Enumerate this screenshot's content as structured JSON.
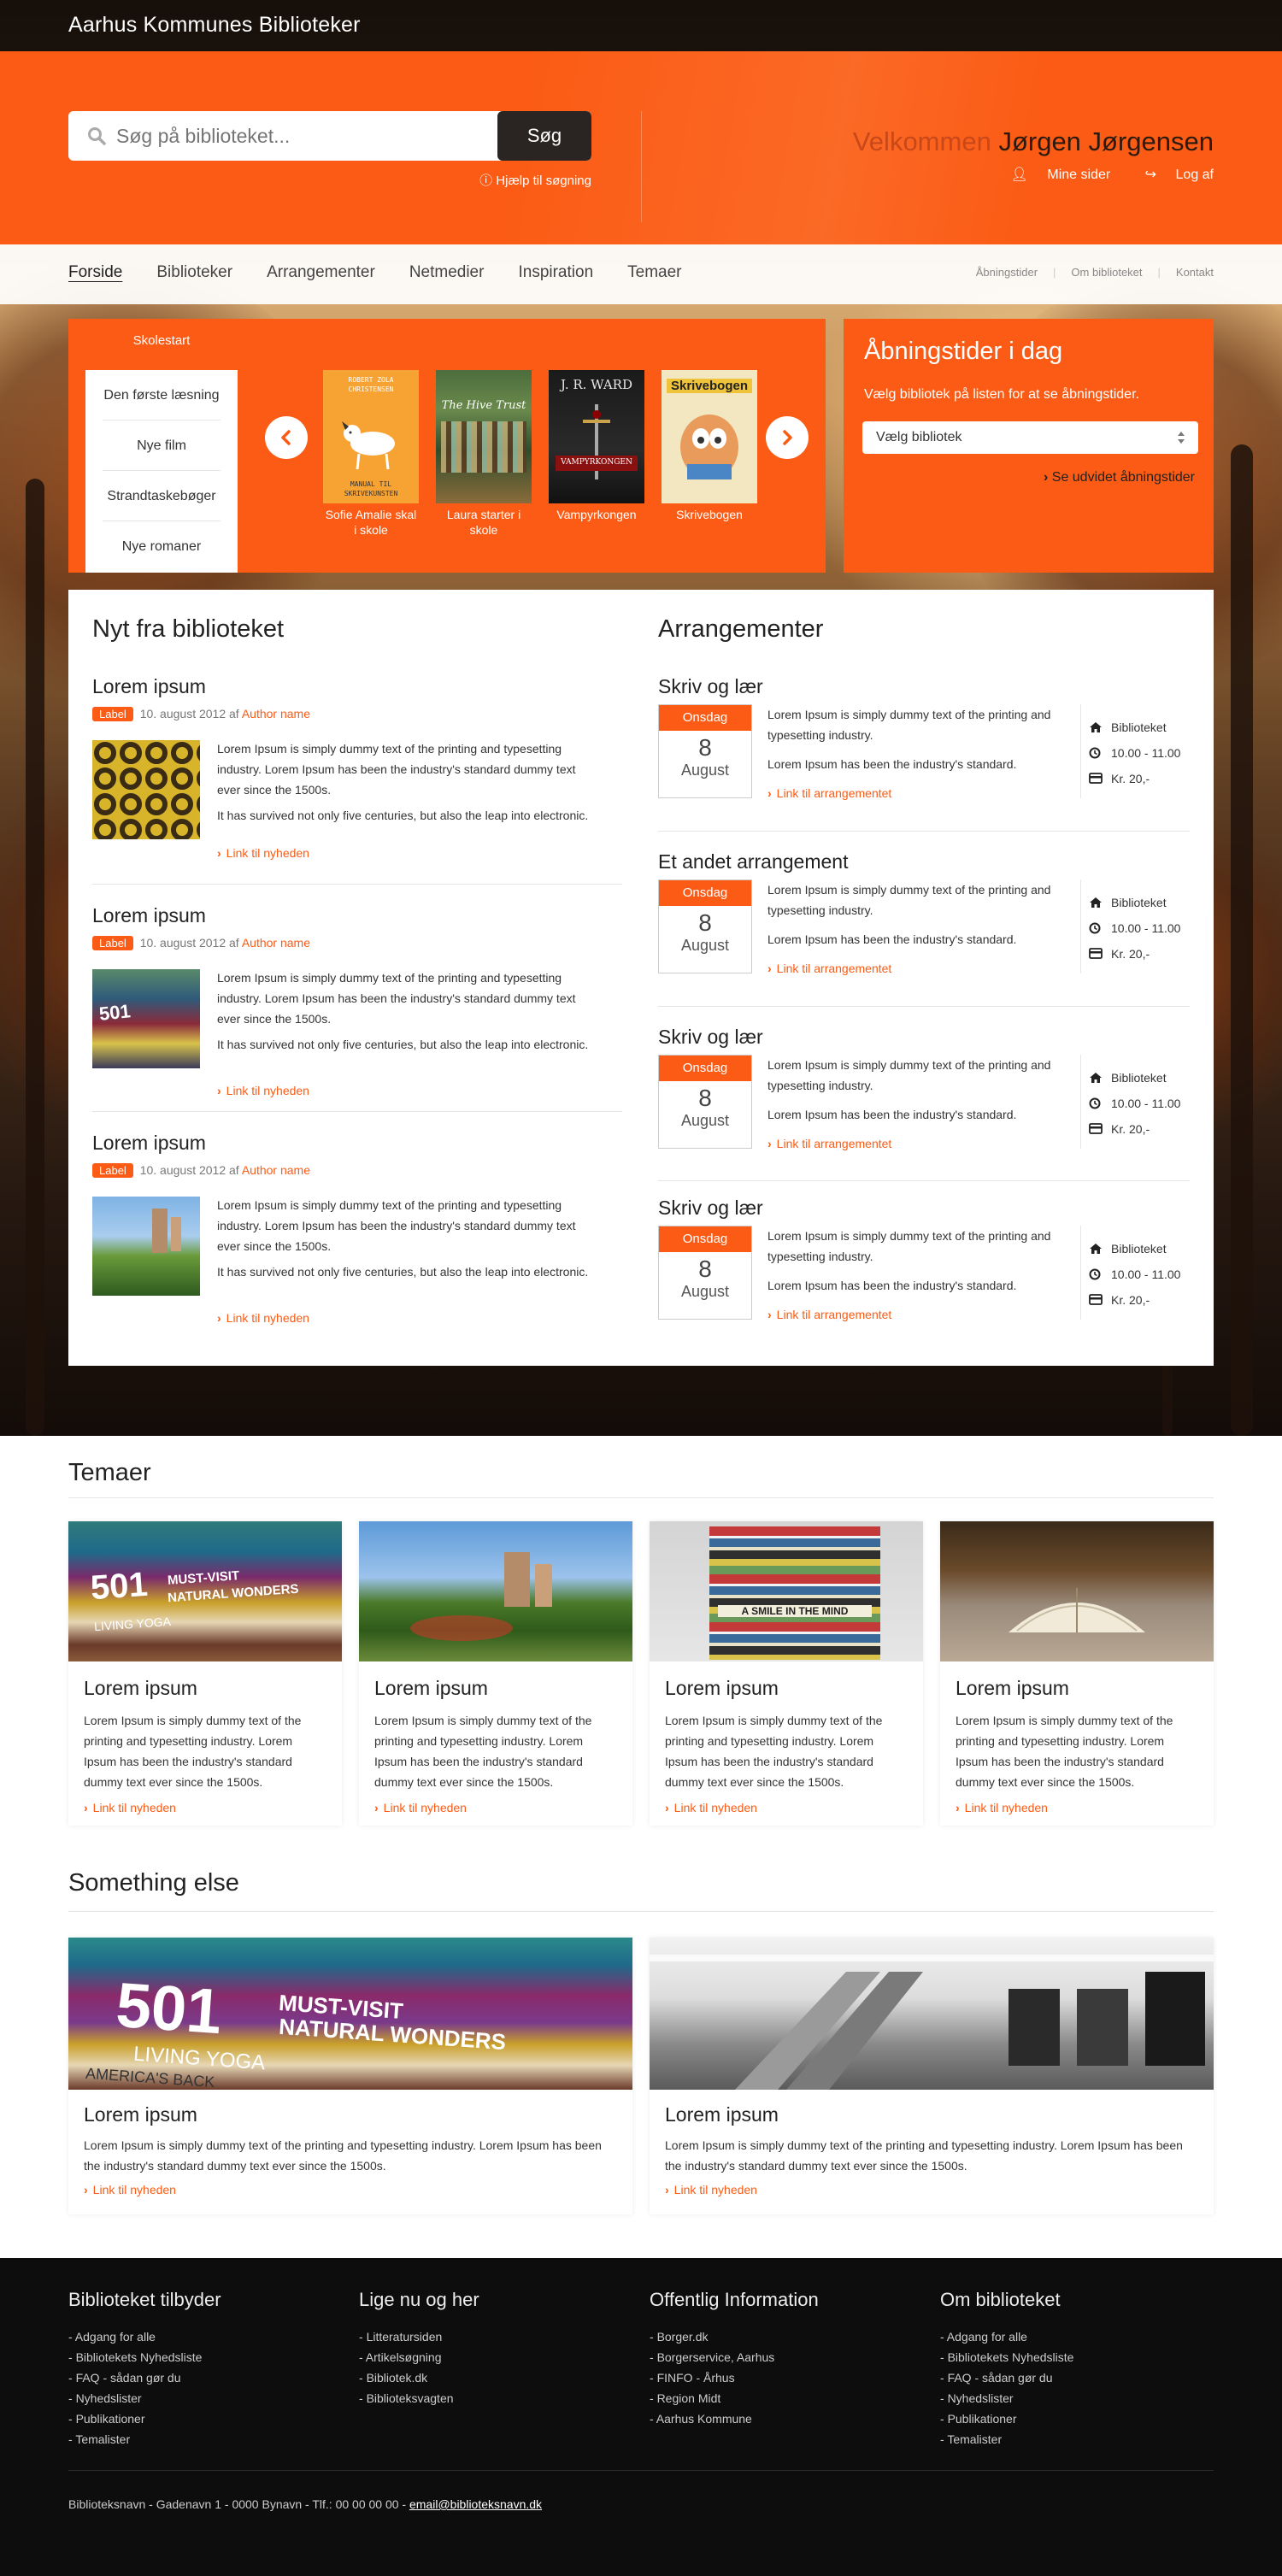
{
  "header": {
    "site_title": "Aarhus Kommunes Biblioteker"
  },
  "search": {
    "placeholder": "Søg på biblioteket...",
    "button": "Søg",
    "help": "Hjælp til søgning"
  },
  "user": {
    "welcome": "Velkommen",
    "name": "Jørgen Jørgensen",
    "my_pages": "Mine sider",
    "logout": "Log af"
  },
  "nav": {
    "items": [
      "Forside",
      "Biblioteker",
      "Arrangementer",
      "Netmedier",
      "Inspiration",
      "Temaer"
    ],
    "utility": [
      "Åbningstider",
      "Om biblioteket",
      "Kontakt"
    ]
  },
  "carousel": {
    "active_category": "Skolestart",
    "categories": [
      "Den første læsning",
      "Nye film",
      "Strandtaskebøger",
      "Nye romaner"
    ],
    "books": [
      {
        "title": "Sofie Amalie skal i skole",
        "cover_author": "ROBERT ZOLA CHRISTENSEN",
        "cover_title": "MANUAL TIL SKRIVEKUNSTEN"
      },
      {
        "title": "Laura starter i skole",
        "cover_title": "The Hive Trust"
      },
      {
        "title": "Vampyrkongen",
        "cover_author": "J. R. WARD",
        "cover_title": "VAMPYRKONGEN"
      },
      {
        "title": "Skrivebogen",
        "cover_title": "Skrivebogen"
      }
    ]
  },
  "hours": {
    "title": "Åbningstider i dag",
    "subtitle": "Vælg bibliotek på listen for at se åbningstider.",
    "select": "Vælg bibliotek",
    "link": "Se udvidet åbningstider"
  },
  "news": {
    "heading": "Nyt fra biblioteket",
    "items": [
      {
        "title": "Lorem ipsum",
        "label": "Label",
        "date": "10. august 2012 af",
        "author": "Author name",
        "p1": "Lorem Ipsum is simply dummy text of the printing and typesetting industry. Lorem Ipsum has been the industry's standard dummy text ever since the 1500s.",
        "p2": "It has survived not only five centuries, but also the leap into electronic.",
        "link": "Link til nyheden"
      },
      {
        "title": "Lorem ipsum",
        "label": "Label",
        "date": "10. august 2012 af",
        "author": "Author name",
        "p1": "Lorem Ipsum is simply dummy text of the printing and typesetting industry. Lorem Ipsum has been the industry's standard dummy text ever since the 1500s.",
        "p2": "It has survived not only five centuries, but also the leap into electronic.",
        "link": "Link til nyheden"
      },
      {
        "title": "Lorem ipsum",
        "label": "Label",
        "date": "10. august 2012 af",
        "author": "Author name",
        "p1": "Lorem Ipsum is simply dummy text of the printing and typesetting industry. Lorem Ipsum has been the industry's standard dummy text ever since the 1500s.",
        "p2": "It has survived not only five centuries, but also the leap into electronic.",
        "link": "Link til nyheden"
      }
    ]
  },
  "events": {
    "heading": "Arrangementer",
    "items": [
      {
        "title": "Skriv og lær",
        "day": "Onsdag",
        "date": "8",
        "month": "August",
        "p1": "Lorem Ipsum is simply dummy text of the printing and typesetting industry.",
        "p2": "Lorem Ipsum has been the industry's standard.",
        "link": "Link til arrangementet",
        "place": "Biblioteket",
        "time": "10.00 - 11.00",
        "price": "Kr. 20,-"
      },
      {
        "title": "Et andet arrangement",
        "day": "Onsdag",
        "date": "8",
        "month": "August",
        "p1": "Lorem Ipsum is simply dummy text of the printing and typesetting industry.",
        "p2": "Lorem Ipsum has been the industry's standard.",
        "link": "Link til arrangementet",
        "place": "Biblioteket",
        "time": "10.00 - 11.00",
        "price": "Kr. 20,-"
      },
      {
        "title": "Skriv og lær",
        "day": "Onsdag",
        "date": "8",
        "month": "August",
        "p1": "Lorem Ipsum is simply dummy text of the printing and typesetting industry.",
        "p2": "Lorem Ipsum has been the industry's standard.",
        "link": "Link til arrangementet",
        "place": "Biblioteket",
        "time": "10.00 - 11.00",
        "price": "Kr. 20,-"
      },
      {
        "title": "Skriv og lær",
        "day": "Onsdag",
        "date": "8",
        "month": "August",
        "p1": "Lorem Ipsum is simply dummy text of the printing and typesetting industry.",
        "p2": "Lorem Ipsum has been the industry's standard.",
        "link": "Link til arrangementet",
        "place": "Biblioteket",
        "time": "10.00 - 11.00",
        "price": "Kr. 20,-"
      }
    ]
  },
  "temaer": {
    "heading": "Temaer",
    "cards": [
      {
        "title": "Lorem ipsum",
        "text": "Lorem Ipsum is simply dummy text of the printing and typesetting industry. Lorem Ipsum has been the industry's standard dummy text ever since the 1500s.",
        "link": "Link til nyheden"
      },
      {
        "title": "Lorem ipsum",
        "text": "Lorem Ipsum is simply dummy text of the printing and typesetting industry. Lorem Ipsum has been the industry's standard dummy text ever since the 1500s.",
        "link": "Link til nyheden"
      },
      {
        "title": "Lorem ipsum",
        "text": "Lorem Ipsum is simply dummy text of the printing and typesetting industry. Lorem Ipsum has been the industry's standard dummy text ever since the 1500s.",
        "link": "Link til nyheden"
      },
      {
        "title": "Lorem ipsum",
        "text": "Lorem Ipsum is simply dummy text of the printing and typesetting industry. Lorem Ipsum has been the industry's standard dummy text ever since the 1500s.",
        "link": "Link til nyheden"
      }
    ]
  },
  "something": {
    "heading": "Something else",
    "cards": [
      {
        "title": "Lorem ipsum",
        "text": "Lorem Ipsum is simply dummy text of the printing and typesetting industry. Lorem Ipsum has been the industry's standard dummy text ever since the 1500s.",
        "link": "Link til nyheden"
      },
      {
        "title": "Lorem ipsum",
        "text": "Lorem Ipsum is simply dummy text of the printing and typesetting industry. Lorem Ipsum has been the industry's standard dummy text ever since the 1500s.",
        "link": "Link til nyheden"
      }
    ]
  },
  "book_spines": {
    "big": "501",
    "must": "MUST-VISIT",
    "natural": "NATURAL WONDERS",
    "yoga": "LIVING YOGA",
    "america": "AMERICA'S BACK",
    "smile": "A SMILE IN THE MIND"
  },
  "footer": {
    "columns": [
      {
        "heading": "Biblioteket tilbyder",
        "items": [
          "Adgang for alle",
          "Bibliotekets Nyhedsliste",
          "FAQ - sådan gør du",
          "Nyhedslister",
          "Publikationer",
          "Temalister"
        ]
      },
      {
        "heading": "Lige nu og her",
        "items": [
          "Litteratursiden",
          "Artikelsøgning",
          "Bibliotek.dk",
          "Biblioteksvagten"
        ]
      },
      {
        "heading": "Offentlig Information",
        "items": [
          "Borger.dk",
          "Borgerservice, Aarhus",
          "FINFO - Århus",
          "Region Midt",
          "Aarhus Kommune"
        ]
      },
      {
        "heading": "Om biblioteket",
        "items": [
          "Adgang for alle",
          "Bibliotekets Nyhedsliste",
          "FAQ - sådan gør du",
          "Nyhedslister",
          "Publikationer",
          "Temalister"
        ]
      }
    ],
    "address": "Biblioteksnavn - Gadenavn 1 - 0000 Bynavn - Tlf.: 00 00 00 00 -",
    "email": "email@biblioteksnavn.dk"
  },
  "colors": {
    "accent": "#fb5b14",
    "dark": "#141414"
  }
}
